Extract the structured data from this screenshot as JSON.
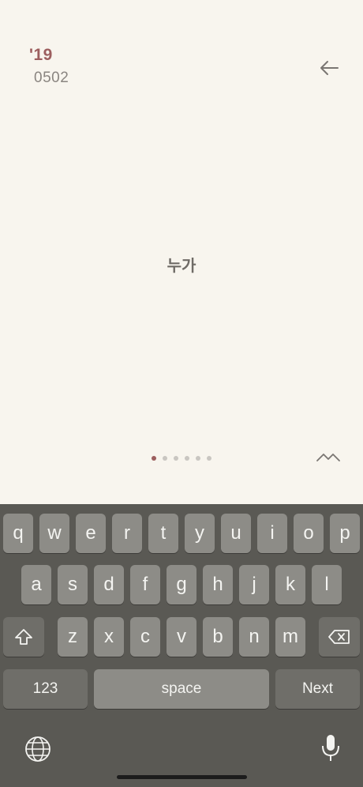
{
  "header": {
    "year": "'19",
    "date": "0502"
  },
  "main": {
    "prompt": "누가"
  },
  "pagination": {
    "count": 6,
    "active_index": 0
  },
  "keyboard": {
    "row1": [
      "q",
      "w",
      "e",
      "r",
      "t",
      "y",
      "u",
      "i",
      "o",
      "p"
    ],
    "row2": [
      "a",
      "s",
      "d",
      "f",
      "g",
      "h",
      "j",
      "k",
      "l"
    ],
    "row3": [
      "z",
      "x",
      "c",
      "v",
      "b",
      "n",
      "m"
    ],
    "numbers_label": "123",
    "space_label": "space",
    "next_label": "Next"
  },
  "colors": {
    "accent": "#9c5e5e",
    "background": "#f8f5ee",
    "keyboard_bg": "#5a5954",
    "key": "#8d8c87"
  }
}
